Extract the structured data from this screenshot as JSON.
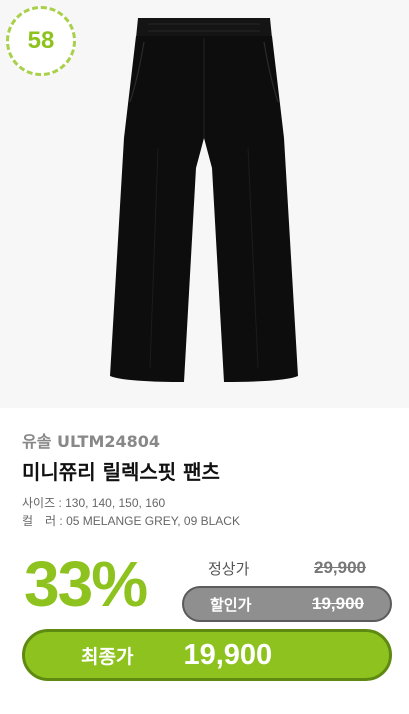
{
  "badge": {
    "rank": "58"
  },
  "product": {
    "brand_line": "유솔 ULTM24804",
    "name": "미니쮸리 릴렉스핏 팬츠",
    "size_spec": "사이즈 : 130, 140, 150, 160",
    "color_spec": "컬　러 : 05 MELANGE GREY, 09 BLACK",
    "image_icon": "black-pants-icon"
  },
  "pricing": {
    "discount": "33%",
    "regular_label": "정상가",
    "regular_price": "29,900",
    "sale_label": "할인가",
    "sale_price": "19,900",
    "final_label": "최종가",
    "final_price": "19,900"
  },
  "colors": {
    "accent": "#8dc21f",
    "sale_pill": "#8f8f8f",
    "garment": "#0d0d0d"
  }
}
